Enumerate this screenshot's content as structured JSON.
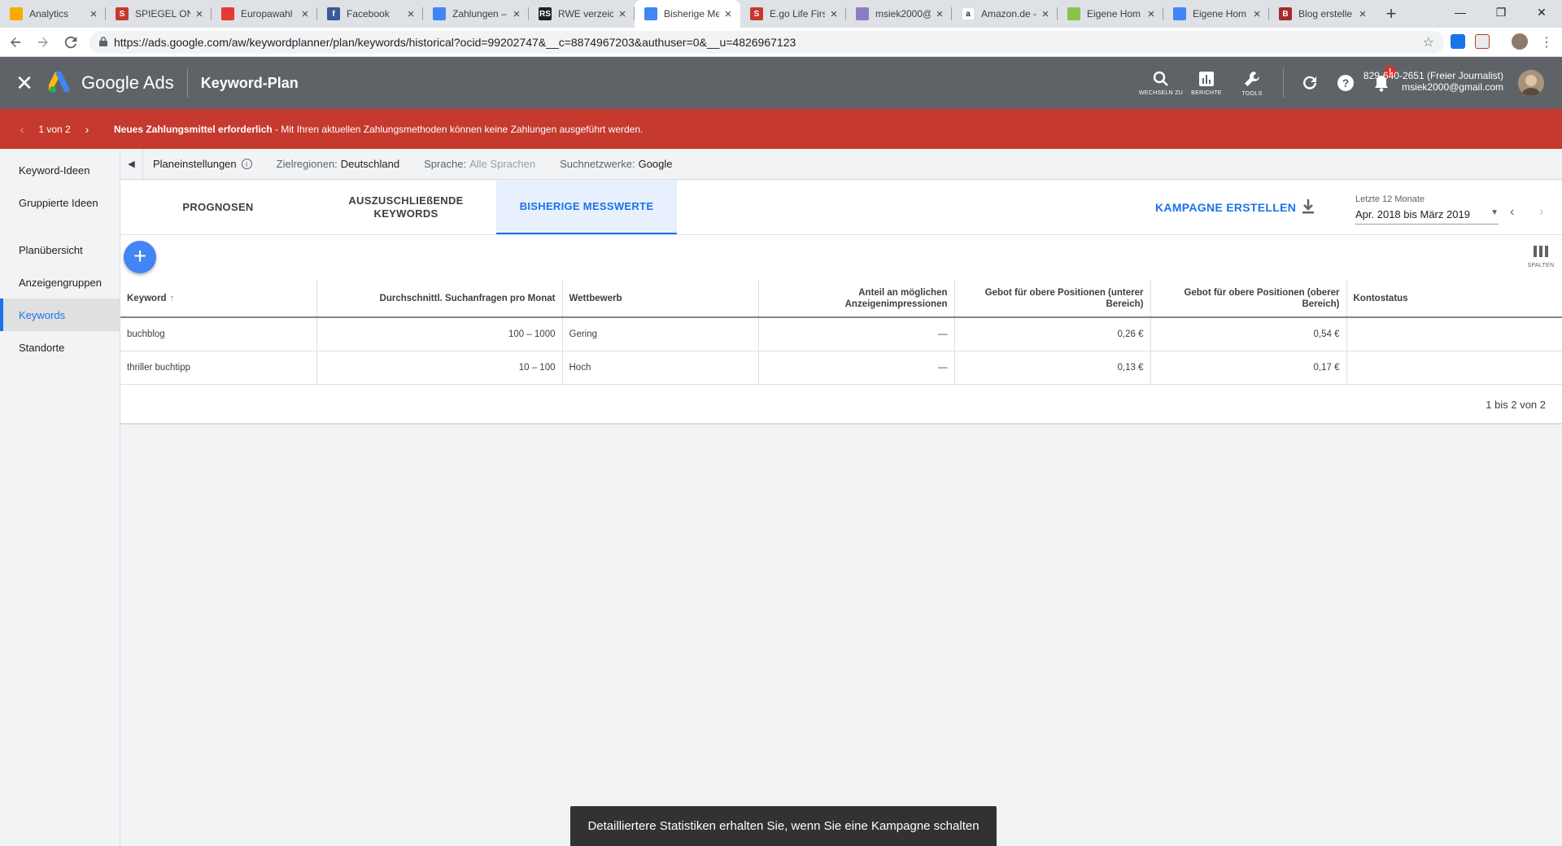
{
  "browser": {
    "tabs": [
      {
        "title": "Analytics",
        "favicon_color": "#f9ab00",
        "favicon_glyph": "",
        "active": false
      },
      {
        "title": "SPIEGEL ONL",
        "favicon_color": "#c5392e",
        "favicon_glyph": "S",
        "active": false
      },
      {
        "title": "Europawahl",
        "favicon_color": "#e53935",
        "favicon_glyph": "",
        "active": false
      },
      {
        "title": "Facebook",
        "favicon_color": "#3b5998",
        "favicon_glyph": "f",
        "active": false
      },
      {
        "title": "Zahlungen –",
        "favicon_color": "#4285f4",
        "favicon_glyph": "",
        "active": false
      },
      {
        "title": "RWE verzeic",
        "favicon_color": "#202124",
        "favicon_glyph": "RS",
        "active": false
      },
      {
        "title": "Bisherige Me",
        "favicon_color": "#4285f4",
        "favicon_glyph": "",
        "active": true
      },
      {
        "title": "E.go Life Firs",
        "favicon_color": "#c5392e",
        "favicon_glyph": "S",
        "active": false
      },
      {
        "title": "msiek2000@",
        "favicon_color": "#8e7cc3",
        "favicon_glyph": "",
        "active": false
      },
      {
        "title": "Amazon.de –",
        "favicon_color": "#ffffff",
        "favicon_glyph": "a",
        "active": false
      },
      {
        "title": "Eigene Hom",
        "favicon_color": "#8bc34a",
        "favicon_glyph": "",
        "active": false
      },
      {
        "title": "Eigene Hom",
        "favicon_color": "#4285f4",
        "favicon_glyph": "",
        "active": false
      },
      {
        "title": "Blog erstelle",
        "favicon_color": "#a52a2a",
        "favicon_glyph": "B",
        "active": false
      }
    ],
    "tab_close_glyph": "×",
    "new_tab_glyph": "+",
    "url": "https://ads.google.com/aw/keywordplanner/plan/keywords/historical?ocid=99202747&__c=8874967203&authuser=0&__u=4826967123",
    "win_minimize": "—",
    "win_restore": "❐",
    "win_close": "✕"
  },
  "header": {
    "app_name": "Google Ads",
    "page_title": "Keyword-Plan",
    "icons": [
      {
        "name": "search-icon",
        "label": "WECHSELN ZU"
      },
      {
        "name": "reports-icon",
        "label": "BERICHTE"
      },
      {
        "name": "tools-icon",
        "label": "TOOLS"
      }
    ],
    "notification_badge": "!",
    "account_id": "829-640-2651 (Freier Journalist)",
    "account_email": "msiek2000@gmail.com"
  },
  "banner": {
    "pager": "1 von 2",
    "title": "Neues Zahlungsmittel erforderlich",
    "message": " - Mit Ihren aktuellen Zahlungsmethoden können keine Zahlungen ausgeführt werden.",
    "color": "#c5392e"
  },
  "sidebar": {
    "items": [
      {
        "label": "Keyword-Ideen",
        "active": false
      },
      {
        "label": "Gruppierte Ideen",
        "active": false
      },
      {
        "label": "Planübersicht",
        "active": false
      },
      {
        "label": "Anzeigengruppen",
        "active": false
      },
      {
        "label": "Keywords",
        "active": true
      },
      {
        "label": "Standorte",
        "active": false
      }
    ]
  },
  "settings": {
    "label": "Planeinstellungen",
    "region_key": "Zielregionen:",
    "region_value": "Deutschland",
    "language_key": "Sprache:",
    "language_value": "Alle Sprachen",
    "network_key": "Suchnetzwerke:",
    "network_value": "Google"
  },
  "tabs": [
    {
      "label": "PROGNOSEN",
      "active": false
    },
    {
      "label": "AUSZUSCHLIEßENDE KEYWORDS",
      "active": false
    },
    {
      "label": "BISHERIGE MESSWERTE",
      "active": true
    }
  ],
  "toolbar": {
    "create_campaign": "KAMPAGNE ERSTELLEN",
    "date_caption": "Letzte 12 Monate",
    "date_value": "Apr. 2018 bis März 2019",
    "columns_label": "SPALTEN"
  },
  "table": {
    "columns": [
      "Keyword",
      "Durchschnittl. Suchanfragen pro Monat",
      "Wettbewerb",
      "Anteil an möglichen Anzeigenimpressionen",
      "Gebot für obere Positionen (unterer Bereich)",
      "Gebot für obere Positionen (oberer Bereich)",
      "Kontostatus"
    ],
    "rows": [
      [
        "buchblog",
        "100 – 1000",
        "Gering",
        "—",
        "0,26 €",
        "0,54 €",
        ""
      ],
      [
        "thriller buchtipp",
        "10 – 100",
        "Hoch",
        "—",
        "0,13 €",
        "0,17 €",
        ""
      ]
    ],
    "footer": "1 bis 2 von 2"
  },
  "toast": "Detailliertere Statistiken erhalten Sie, wenn Sie eine Kampagne schalten",
  "colors": {
    "accent": "#1a73e8",
    "header_bg": "#5f6368",
    "fab": "#4285f4"
  }
}
